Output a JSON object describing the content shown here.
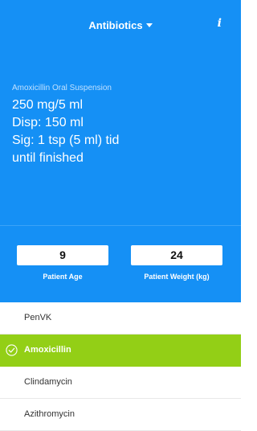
{
  "header": {
    "title": "Antibiotics",
    "info_label": "i"
  },
  "prescription": {
    "drug_name": "Amoxicillin Oral Suspension",
    "lines": [
      "250 mg/5 ml",
      "Disp: 150 ml",
      "Sig: 1 tsp (5 ml) tid",
      "until finished"
    ]
  },
  "inputs": {
    "age": {
      "value": "9",
      "label": "Patient Age"
    },
    "weight": {
      "value": "24",
      "label": "Patient Weight (kg)"
    }
  },
  "drugs": [
    {
      "label": "PenVK",
      "selected": false
    },
    {
      "label": "Amoxicillin",
      "selected": true
    },
    {
      "label": "Clindamycin",
      "selected": false
    },
    {
      "label": "Azithromycin",
      "selected": false
    }
  ],
  "colors": {
    "primary": "#1590f5",
    "selected": "#93cf16"
  },
  "icons": {
    "title_dropdown": "chevron-down-icon",
    "info": "info-icon",
    "selected_check": "check-circle-icon"
  }
}
